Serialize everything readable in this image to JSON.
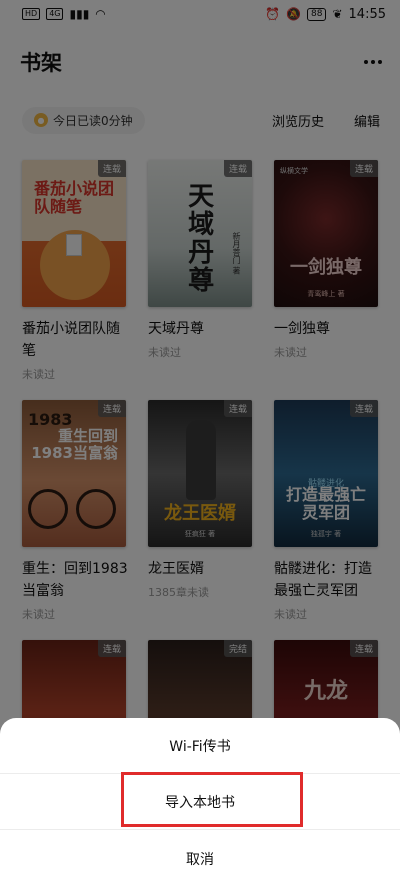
{
  "status_bar": {
    "left_badges": [
      "HD",
      "4G"
    ],
    "battery": "88",
    "time": "14:55"
  },
  "header": {
    "title": "书架",
    "more_icon": "more-horizontal-icon"
  },
  "toolbar": {
    "reading_today": "今日已读0分钟",
    "history_label": "浏览历史",
    "edit_label": "编辑"
  },
  "books": [
    {
      "title": "番茄小说团队随笔",
      "status": "未读过",
      "badge": "连载",
      "cover_text": "番茄小说团队随笔"
    },
    {
      "title": "天域丹尊",
      "status": "未读过",
      "badge": "连载",
      "cover_text": "天域丹尊",
      "cover_author": "新月菩门 著"
    },
    {
      "title": "一剑独尊",
      "status": "未读过",
      "badge": "连载",
      "cover_text": "一剑独尊",
      "cover_sub": "青鸾峰上 著",
      "cover_logo": "纵横文学"
    },
    {
      "title": "重生：回到1983当富翁",
      "status": "未读过",
      "badge": "连载",
      "cover_text": "重生回到1983当富翁",
      "cover_num": "1983"
    },
    {
      "title": "龙王医婿",
      "status": "1385章未读",
      "badge": "连载",
      "cover_text": "龙王医婿",
      "cover_author": "狂疯狂 著"
    },
    {
      "title": "骷髅进化：打造最强亡灵军团",
      "status": "未读过",
      "badge": "连载",
      "cover_text": "打造最强亡灵军团",
      "cover_top": "骷髅进化",
      "cover_sub": "独孤宇 著"
    },
    {
      "title": "",
      "status": "",
      "badge": "连载",
      "cover_text": ""
    },
    {
      "title": "",
      "status": "",
      "badge": "完结",
      "cover_text": ""
    },
    {
      "title": "",
      "status": "",
      "badge": "连载",
      "cover_text": "九龙"
    }
  ],
  "sheet": {
    "wifi_transfer": "Wi-Fi传书",
    "import_local": "导入本地书",
    "cancel": "取消"
  },
  "colors": {
    "overlay": "rgba(0,0,0,0.5)",
    "highlight": "#e02b2b"
  }
}
